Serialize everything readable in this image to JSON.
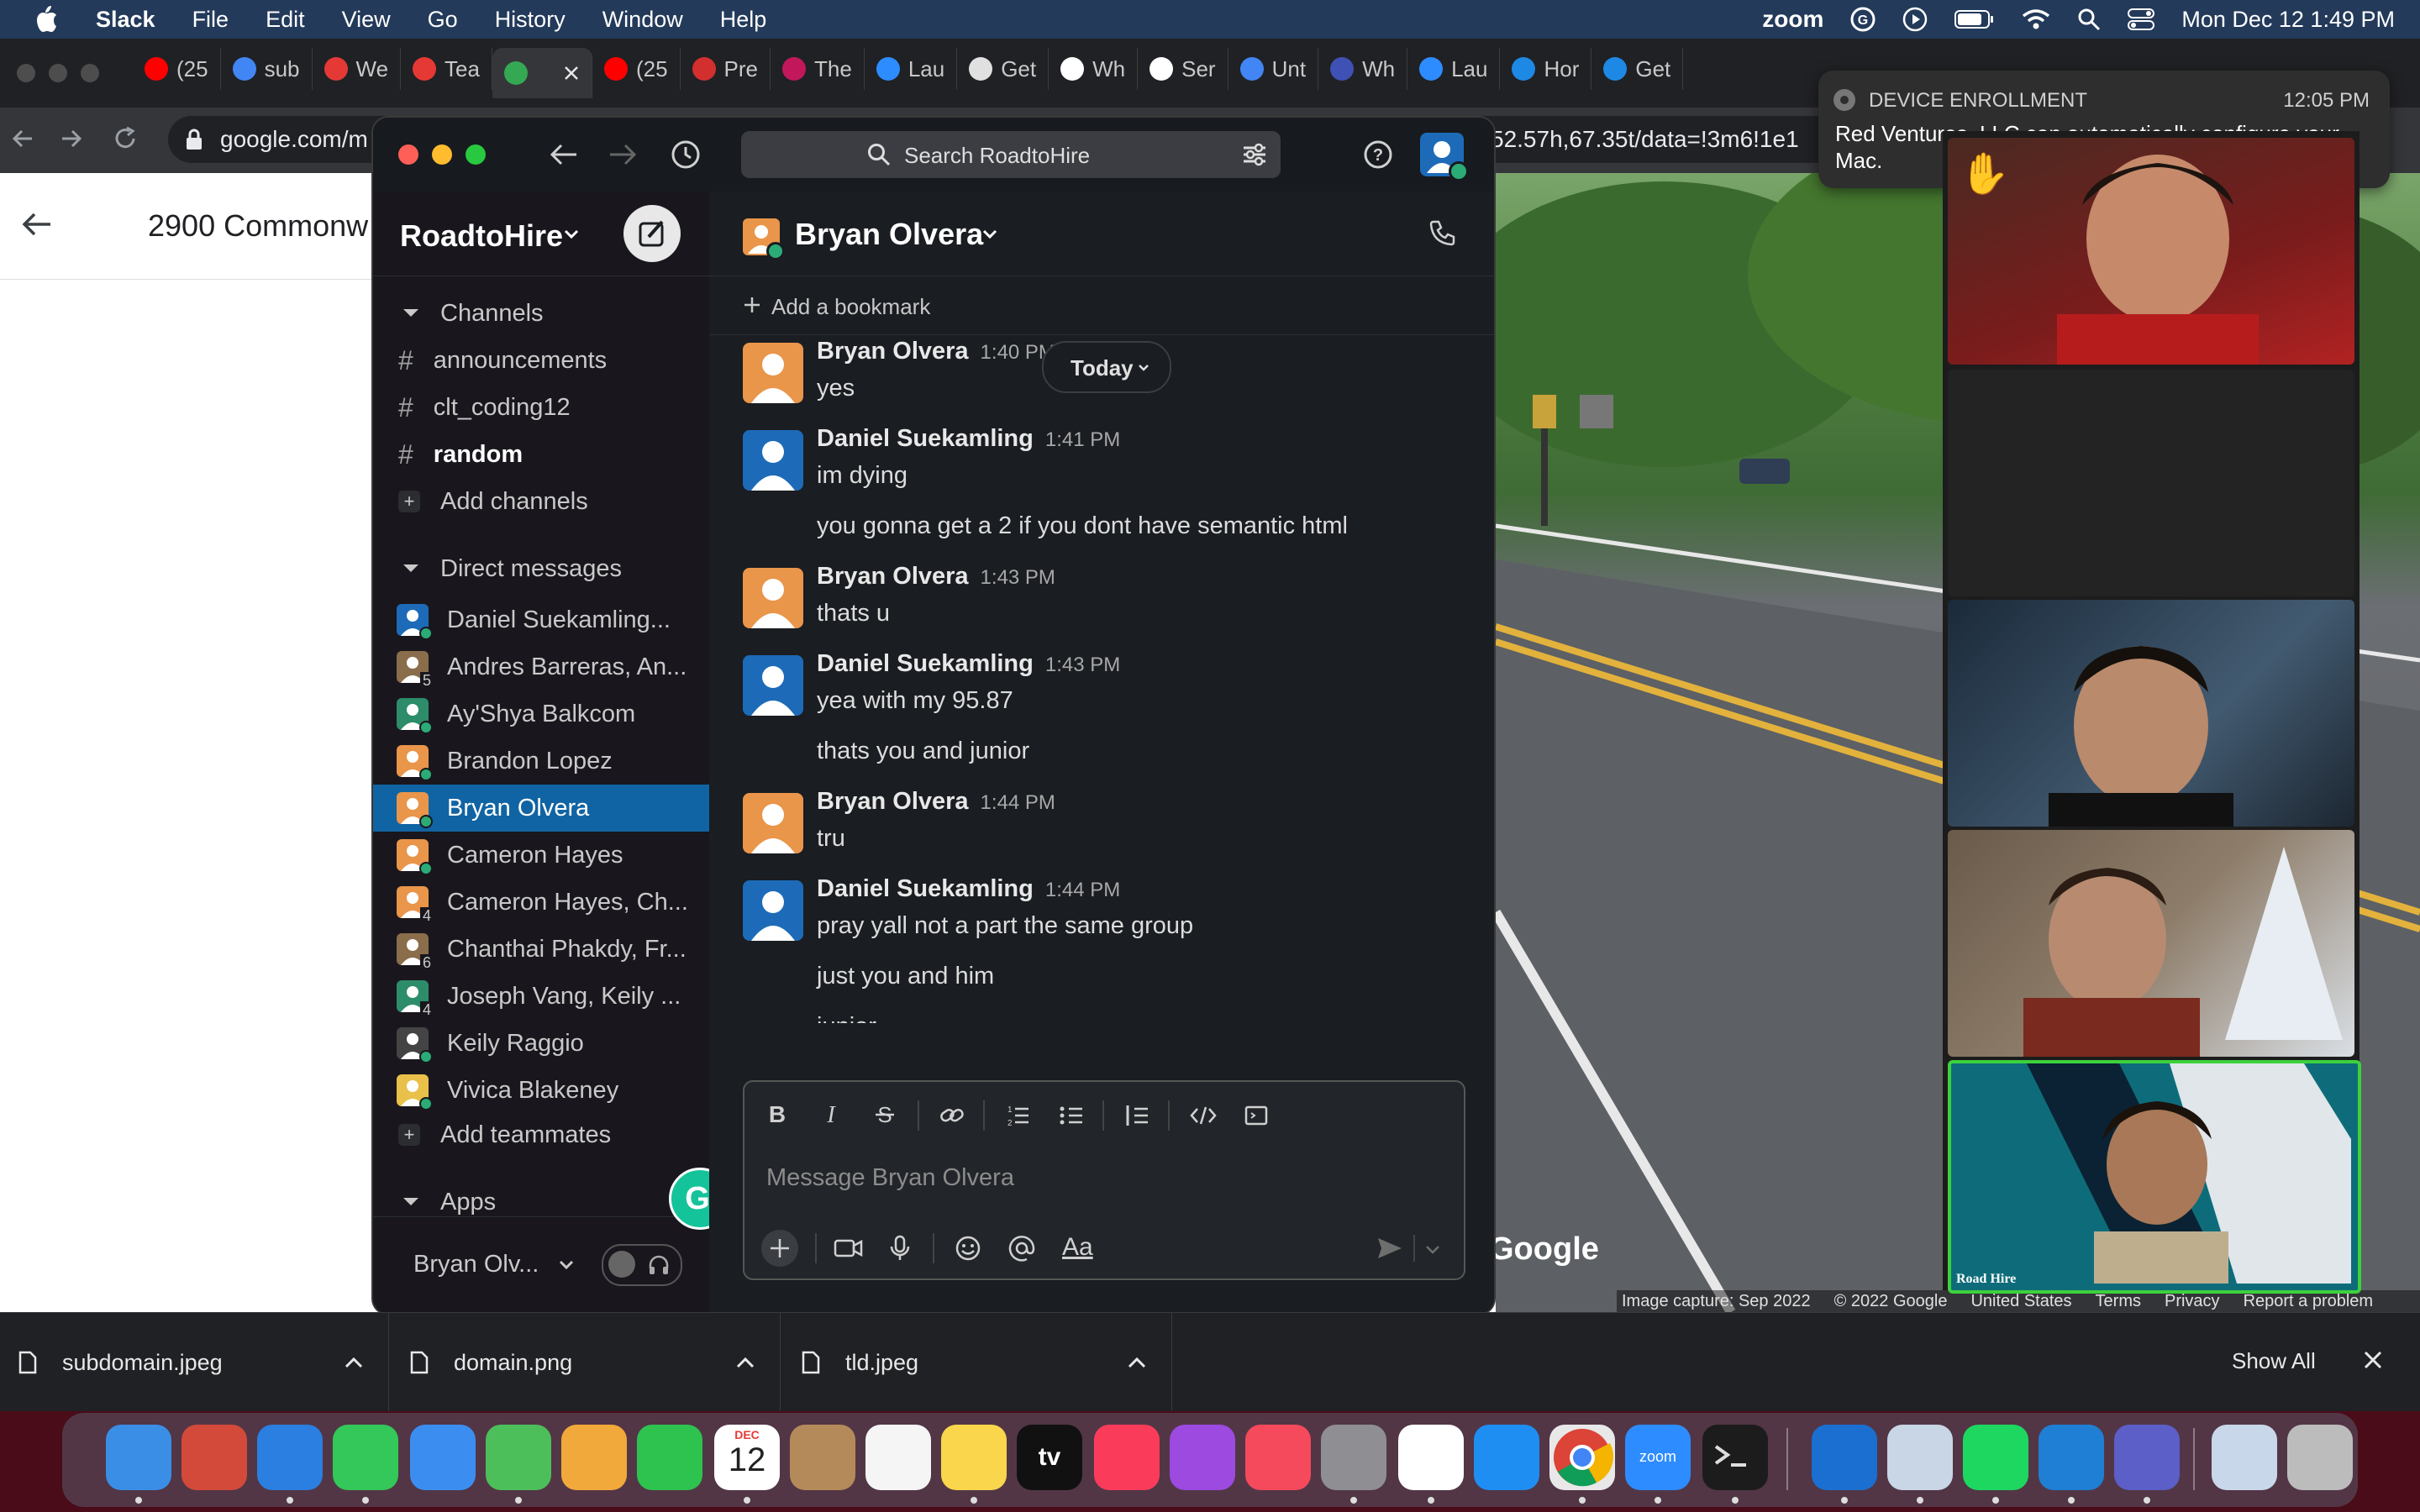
{
  "menubar": {
    "apple": "",
    "app_name": "Slack",
    "menus": [
      "File",
      "Edit",
      "View",
      "Go",
      "History",
      "Window",
      "Help"
    ],
    "zoom_label": "zoom",
    "datetime": "Mon Dec 12  1:49 PM"
  },
  "browser": {
    "tabs": [
      {
        "label": "(25",
        "color": "#ff0000"
      },
      {
        "label": "sub",
        "color": "#4285f4"
      },
      {
        "label": "We",
        "color": "#e53935"
      },
      {
        "label": "Tea",
        "color": "#e53935"
      },
      {
        "label": "",
        "color": "#34a853"
      },
      {
        "label": "(25",
        "color": "#ff0000"
      },
      {
        "label": "Pre",
        "color": "#d32f2f"
      },
      {
        "label": "The",
        "color": "#c2185b"
      },
      {
        "label": "Lau",
        "color": "#2d8cff"
      },
      {
        "label": "Get",
        "color": "#e0e0e0"
      },
      {
        "label": "Wh",
        "color": "#ffffff"
      },
      {
        "label": "Ser",
        "color": "#ffffff"
      },
      {
        "label": "Unt",
        "color": "#4285f4"
      },
      {
        "label": "Wh",
        "color": "#3f51b5"
      },
      {
        "label": "Lau",
        "color": "#2d8cff"
      },
      {
        "label": "Hor",
        "color": "#1e88e5"
      },
      {
        "label": "Get",
        "color": "#1e88e5"
      }
    ],
    "url_left": "google.com/m",
    "url_right": "52.57h,67.35t/data=!3m6!1e1"
  },
  "maps": {
    "back_label": "←",
    "place_title": "2900 Commonw",
    "attribution": [
      "Image capture: Sep 2022",
      "© 2022 Google",
      "United States",
      "Terms",
      "Privacy",
      "Report a problem"
    ],
    "google_watermark": "Google"
  },
  "notification": {
    "title": "DEVICE ENROLLMENT",
    "time": "12:05 PM",
    "line1": "Red Ventures, LLC can automatically configure your",
    "line2": "Mac."
  },
  "slack": {
    "search_placeholder": "Search RoadtoHire",
    "workspace": "RoadtoHire",
    "channels_header": "Channels",
    "channels": [
      {
        "name": "announcements",
        "bold": false
      },
      {
        "name": "clt_coding12",
        "bold": false
      },
      {
        "name": "random",
        "bold": true
      }
    ],
    "add_channels": "Add channels",
    "dm_header": "Direct messages",
    "dms": [
      {
        "name": "Daniel Suekamling...",
        "avatar": "#1d6bb8",
        "badge": ""
      },
      {
        "name": "Andres Barreras, An...",
        "avatar": "#8a6d4a",
        "badge": "5"
      },
      {
        "name": "Ay'Shya Balkcom",
        "avatar": "#2d8c6a",
        "badge": ""
      },
      {
        "name": "Brandon Lopez",
        "avatar": "#e9954a",
        "badge": ""
      },
      {
        "name": "Bryan Olvera",
        "avatar": "#e9954a",
        "badge": ""
      },
      {
        "name": "Cameron Hayes",
        "avatar": "#e9954a",
        "badge": ""
      },
      {
        "name": "Cameron Hayes, Ch...",
        "avatar": "#e9954a",
        "badge": "4"
      },
      {
        "name": "Chanthai Phakdy, Fr...",
        "avatar": "#8a6d4a",
        "badge": "6"
      },
      {
        "name": "Joseph Vang, Keily ...",
        "avatar": "#2d8c6a",
        "badge": "4"
      },
      {
        "name": "Keily Raggio",
        "avatar": "#444444",
        "badge": ""
      },
      {
        "name": "Vivica Blakeney",
        "avatar": "#e9c04a",
        "badge": ""
      }
    ],
    "add_teammates": "Add teammates",
    "apps_header": "Apps",
    "footer_user": "Bryan Olv...",
    "channel_title": "Bryan Olvera",
    "add_bookmark": "Add a bookmark",
    "today_label": "Today",
    "messages": [
      {
        "author": "Bryan Olvera",
        "time": "1:40 PM",
        "avatar": "#e9954a",
        "lines": [
          "yes"
        ]
      },
      {
        "author": "Daniel Suekamling",
        "time": "1:41 PM",
        "avatar": "#1d6bb8",
        "lines": [
          "im dying",
          "you gonna get a 2 if you dont have semantic html"
        ]
      },
      {
        "author": "Bryan Olvera",
        "time": "1:43 PM",
        "avatar": "#e9954a",
        "lines": [
          "thats u"
        ]
      },
      {
        "author": "Daniel Suekamling",
        "time": "1:43 PM",
        "avatar": "#1d6bb8",
        "lines": [
          "yea with my 95.87",
          "thats you and junior"
        ]
      },
      {
        "author": "Bryan Olvera",
        "time": "1:44 PM",
        "avatar": "#e9954a",
        "lines": [
          "tru"
        ]
      },
      {
        "author": "Daniel Suekamling",
        "time": "1:44 PM",
        "avatar": "#1d6bb8",
        "lines": [
          "pray yall not a part the same group",
          "just you and him",
          "junior"
        ]
      }
    ],
    "composer_placeholder": "Message Bryan Olvera",
    "format_label": "Aa"
  },
  "zoom": {
    "tile_label": "Road  Hire",
    "raise_hand": "✋"
  },
  "downloads": {
    "files": [
      "subdomain.jpeg",
      "domain.png",
      "tld.jpeg"
    ],
    "show_all": "Show All"
  },
  "dock": {
    "calendar_month": "DEC",
    "calendar_day": "12",
    "tv_label": "tv",
    "zoom_label": "zoom"
  }
}
